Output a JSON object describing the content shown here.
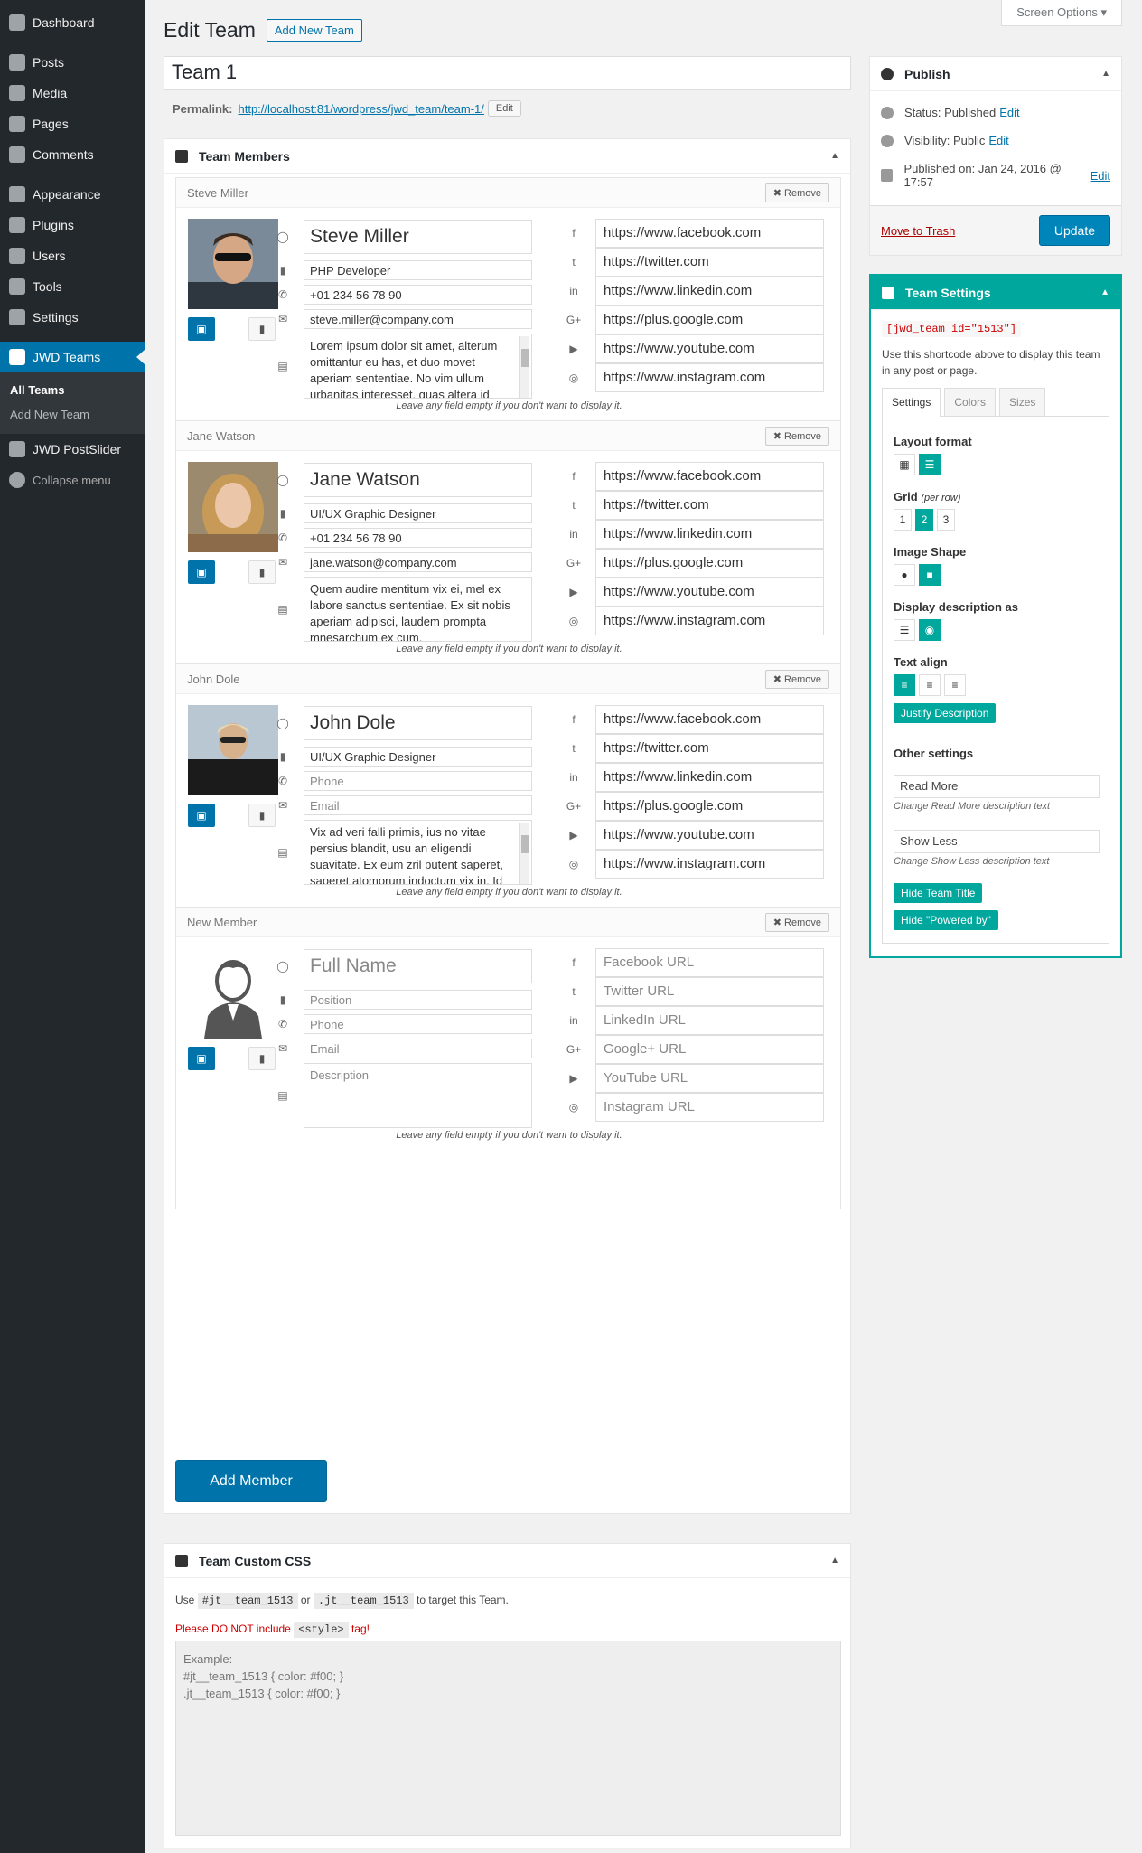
{
  "menu": {
    "items": [
      "Dashboard",
      "Posts",
      "Media",
      "Pages",
      "Comments",
      "Appearance",
      "Plugins",
      "Users",
      "Tools",
      "Settings",
      "JWD Teams",
      "JWD PostSlider",
      "Collapse menu"
    ],
    "sub": [
      "All Teams",
      "Add New Team"
    ]
  },
  "screen_options": "Screen Options ▾",
  "page": {
    "title": "Edit Team",
    "add_new": "Add New Team",
    "post_title": "Team 1",
    "permalink_label": "Permalink:",
    "permalink_url": "http://localhost:81/wordpress/jwd_team/team-1/",
    "edit": "Edit"
  },
  "members_box": {
    "title": "Team Members",
    "remove": "Remove",
    "hint": "Leave any field empty if you don't want to display it.",
    "add_member": "Add Member"
  },
  "members": [
    {
      "label": "Steve Miller",
      "name": "Steve Miller",
      "position": "PHP Developer",
      "phone": "+01 234 56 78 90",
      "email": "steve.miller@company.com",
      "desc": "Lorem ipsum dolor sit amet, alterum omittantur eu has, et duo movet aperiam sententiae. No vim ullum urbanitas interesset, quas altera id quo, praesent facilisis",
      "facebook": "https://www.facebook.com",
      "twitter": "https://twitter.com",
      "linkedin": "https://www.linkedin.com",
      "google": "https://plus.google.com",
      "youtube": "https://www.youtube.com",
      "instagram": "https://www.instagram.com"
    },
    {
      "label": "Jane Watson",
      "name": "Jane Watson",
      "position": "UI/UX Graphic Designer",
      "phone": "+01 234 56 78 90",
      "email": "jane.watson@company.com",
      "desc": "Quem audire mentitum vix ei, mel ex labore sanctus sententiae. Ex sit nobis aperiam adipisci, laudem prompta mnesarchum ex cum.",
      "facebook": "https://www.facebook.com",
      "twitter": "https://twitter.com",
      "linkedin": "https://www.linkedin.com",
      "google": "https://plus.google.com",
      "youtube": "https://www.youtube.com",
      "instagram": "https://www.instagram.com"
    },
    {
      "label": "John Dole",
      "name": "John Dole",
      "position": "UI/UX Graphic Designer",
      "phone": "",
      "email": "",
      "desc": "Vix ad veri falli primis, ius no vitae persius blandit, usu an eligendi suavitate. Ex eum zril putent saperet, saperet atomorum indoctum vix in. Id qui summo",
      "facebook": "https://www.facebook.com",
      "twitter": "https://twitter.com",
      "linkedin": "https://www.linkedin.com",
      "google": "https://plus.google.com",
      "youtube": "https://www.youtube.com",
      "instagram": "https://www.instagram.com"
    },
    {
      "label": "New Member",
      "name": "",
      "position": "",
      "phone": "",
      "email": "",
      "desc": "",
      "facebook": "",
      "twitter": "",
      "linkedin": "",
      "google": "",
      "youtube": "",
      "instagram": ""
    }
  ],
  "placeholders": {
    "name": "Full Name",
    "position": "Position",
    "phone": "Phone",
    "email": "Email",
    "desc": "Description",
    "facebook": "Facebook URL",
    "twitter": "Twitter URL",
    "linkedin": "LinkedIn URL",
    "google": "Google+ URL",
    "youtube": "YouTube URL",
    "instagram": "Instagram URL"
  },
  "css_box": {
    "title": "Team Custom CSS",
    "use": "Use",
    "code1": "#jt__team_1513",
    "or": "or",
    "code2": ".jt__team_1513",
    "target": "to target this Team.",
    "warn1": "Please DO NOT include",
    "code3": "<style>",
    "warn2": "tag!",
    "example": "Example:\n#jt__team_1513 { color: #f00; }\n.jt__team_1513 { color: #f00; }"
  },
  "publish": {
    "title": "Publish",
    "status": "Status: Published",
    "visibility": "Visibility: Public",
    "published_on": "Published on: Jan 24, 2016 @ 17:57",
    "edit": "Edit",
    "trash": "Move to Trash",
    "update": "Update"
  },
  "team_settings": {
    "title": "Team Settings",
    "shortcode": "[jwd_team id=\"1513\"]",
    "help": "Use this shortcode above to display this team in any post or page.",
    "tabs": [
      "Settings",
      "Colors",
      "Sizes"
    ],
    "layout_format": "Layout format",
    "grid": "Grid",
    "per_row": "(per row)",
    "grid_opts": [
      "1",
      "2",
      "3"
    ],
    "image_shape": "Image Shape",
    "display_desc": "Display description as",
    "text_align": "Text align",
    "justify": "Justify Description",
    "other": "Other settings",
    "read_more": "Read More",
    "read_more_hint": "Change Read More description text",
    "show_less": "Show Less",
    "show_less_hint": "Change Show Less description text",
    "hide_title": "Hide Team Title",
    "hide_powered": "Hide \"Powered by\""
  },
  "colors": {
    "accent": "#00a79d",
    "wp_blue": "#0073aa",
    "sidebar": "#23282d"
  }
}
